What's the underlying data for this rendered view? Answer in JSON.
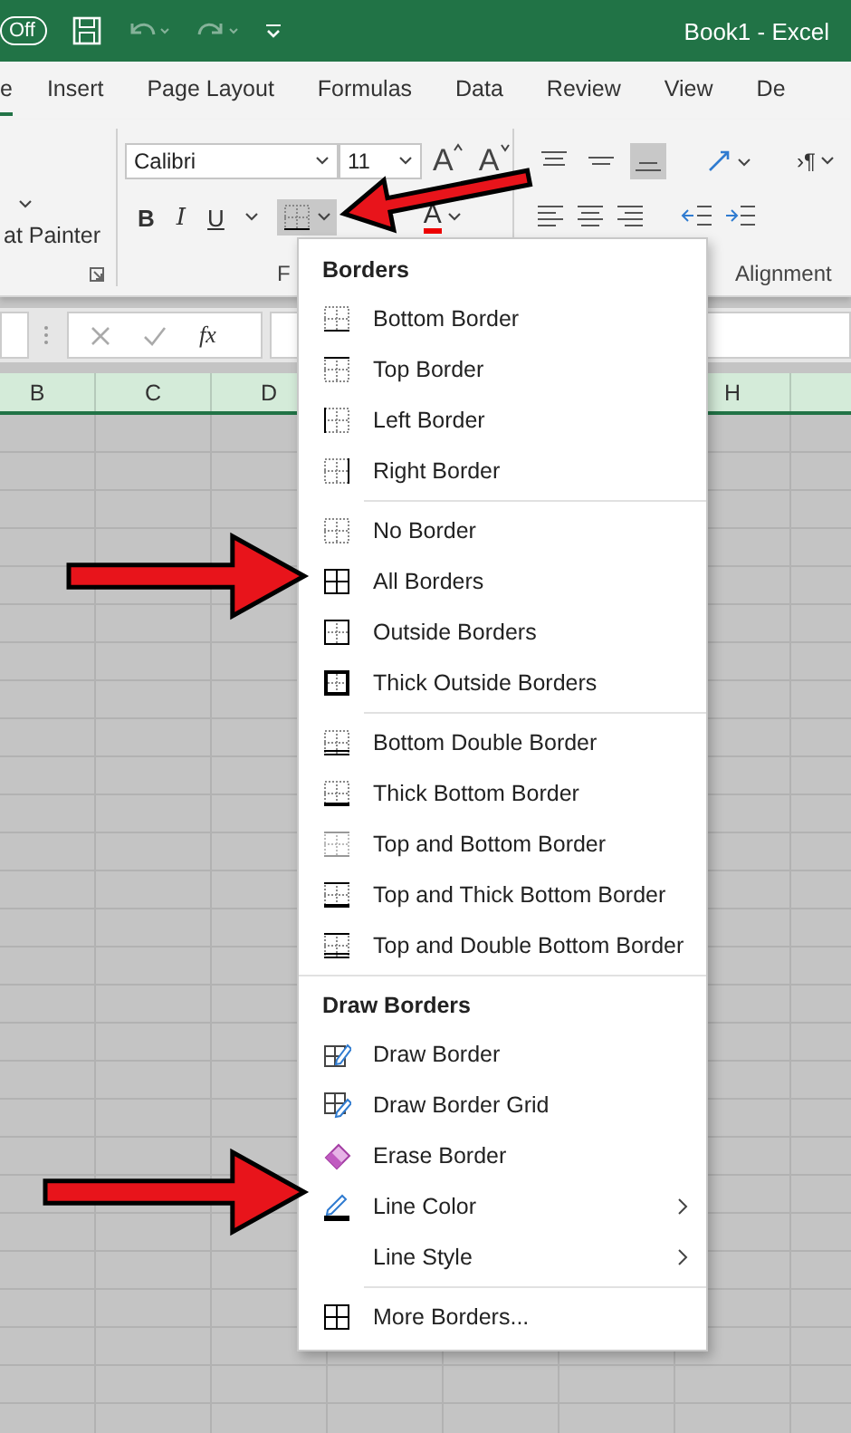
{
  "title_bar": {
    "autosave": "Off",
    "title": "Book1  -  Excel"
  },
  "tabs": [
    {
      "label": "e",
      "selected": true
    },
    {
      "label": "Insert",
      "selected": false
    },
    {
      "label": "Page Layout",
      "selected": false
    },
    {
      "label": "Formulas",
      "selected": false
    },
    {
      "label": "Data",
      "selected": false
    },
    {
      "label": "Review",
      "selected": false
    },
    {
      "label": "View",
      "selected": false
    },
    {
      "label": "De",
      "selected": false
    }
  ],
  "ribbon": {
    "clipboard": {
      "painter_label": "at Painter"
    },
    "font": {
      "name": "Calibri",
      "size": "11",
      "grow": "A",
      "shrink": "A",
      "bold": "B",
      "italic": "I",
      "underline": "U",
      "font_color": "A",
      "group_label": "F"
    },
    "alignment": {
      "text_direction": "›¶",
      "group_label": "Alignment"
    }
  },
  "formula_bar": {
    "fx": "fx"
  },
  "columns": [
    {
      "label": "B"
    },
    {
      "label": "C"
    },
    {
      "label": "D"
    },
    {
      "label": "H"
    }
  ],
  "menu": {
    "groups": [
      {
        "heading": "Borders",
        "items": [
          {
            "label": "Bottom Border",
            "kind": "bottom",
            "submenu": false
          },
          {
            "label": "Top Border",
            "kind": "top",
            "submenu": false
          },
          {
            "label": "Left Border",
            "kind": "left",
            "submenu": false
          },
          {
            "label": "Right Border",
            "kind": "right",
            "submenu": false
          }
        ]
      },
      {
        "items": [
          {
            "label": "No Border",
            "kind": "none",
            "submenu": false
          },
          {
            "label": "All Borders",
            "kind": "all",
            "submenu": false
          },
          {
            "label": "Outside Borders",
            "kind": "outside",
            "submenu": false
          },
          {
            "label": "Thick Outside Borders",
            "kind": "thick-outside",
            "submenu": false
          }
        ]
      },
      {
        "items": [
          {
            "label": "Bottom Double Border",
            "kind": "bottom-double",
            "submenu": false
          },
          {
            "label": "Thick Bottom Border",
            "kind": "thick-bottom",
            "submenu": false
          },
          {
            "label": "Top and Bottom Border",
            "kind": "top-bottom",
            "submenu": false
          },
          {
            "label": "Top and Thick Bottom Border",
            "kind": "top-thick-bottom",
            "submenu": false
          },
          {
            "label": "Top and Double Bottom Border",
            "kind": "top-double-bottom",
            "submenu": false
          }
        ]
      },
      {
        "heading": "Draw Borders",
        "items": [
          {
            "label": "Draw Border",
            "kind": "draw",
            "submenu": false
          },
          {
            "label": "Draw Border Grid",
            "kind": "draw-grid",
            "submenu": false
          },
          {
            "label": "Erase Border",
            "kind": "erase",
            "submenu": false
          },
          {
            "label": "Line Color",
            "kind": "line-color",
            "submenu": true
          },
          {
            "label": "Line Style",
            "submenu": true
          }
        ]
      },
      {
        "items": [
          {
            "label": "More Borders...",
            "kind": "all",
            "submenu": false
          }
        ]
      }
    ]
  }
}
